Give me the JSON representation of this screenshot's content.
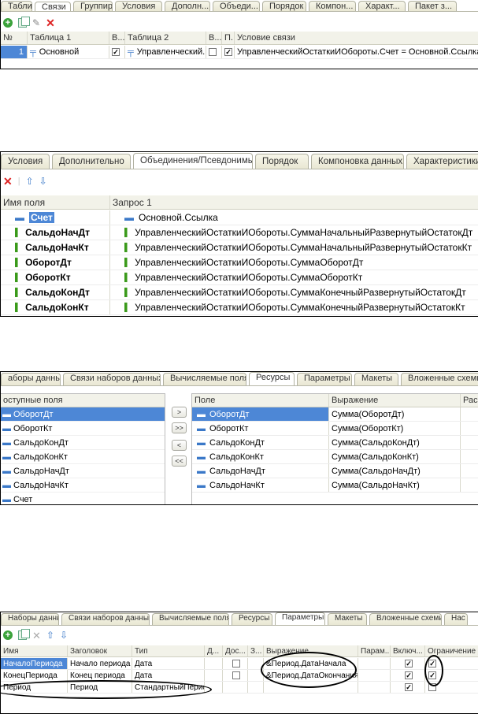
{
  "p1": {
    "tabs": [
      "Таблиц...",
      "Связи",
      "Группир...",
      "Условия",
      "Дополн...",
      "Объеди...",
      "Порядок",
      "Компон...",
      "Характ...",
      "Пакет з..."
    ],
    "headers": [
      "№",
      "Таблица 1",
      "В...",
      "Таблица 2",
      "В...",
      "П...",
      "Условие связи"
    ],
    "row": {
      "num": "1",
      "t1": "Основной",
      "t2": "Управленческий...",
      "cond": "УправленческийОстаткиИОбороты.Счет = Основной.Ссылка"
    }
  },
  "p2": {
    "tabs": [
      "Условия",
      "Дополнительно",
      "Объединения/Псевдонимы",
      "Порядок",
      "Компоновка данных",
      "Характеристики"
    ],
    "headers": [
      "Имя поля",
      "Запрос 1"
    ],
    "rows": [
      {
        "name": "Счет",
        "expr": "Основной.Ссылка"
      },
      {
        "name": "СальдоНачДт",
        "expr": "УправленческийОстаткиИОбороты.СуммаНачальныйРазвернутыйОстатокДт"
      },
      {
        "name": "СальдоНачКт",
        "expr": "УправленческийОстаткиИОбороты.СуммаНачальныйРазвернутыйОстатокКт"
      },
      {
        "name": "ОборотДт",
        "expr": "УправленческийОстаткиИОбороты.СуммаОборотДт"
      },
      {
        "name": "ОборотКт",
        "expr": "УправленческийОстаткиИОбороты.СуммаОборотКт"
      },
      {
        "name": "СальдоКонДт",
        "expr": "УправленческийОстаткиИОбороты.СуммаКонечныйРазвернутыйОстатокДт"
      },
      {
        "name": "СальдоКонКт",
        "expr": "УправленческийОстаткиИОбороты.СуммаКонечныйРазвернутыйОстатокКт"
      }
    ]
  },
  "p3": {
    "tabs": [
      "аборы данных",
      "Связи наборов данных",
      "Вычисляемые поля",
      "Ресурсы",
      "Параметры",
      "Макеты",
      "Вложенные схемы"
    ],
    "left_header": "оступные поля",
    "left": [
      "ОборотДт",
      "ОборотКт",
      "СальдоКонДт",
      "СальдоКонКт",
      "СальдоНачДт",
      "СальдоНачКт",
      "Счет"
    ],
    "buttons": [
      ">",
      ">>",
      "<",
      "<<"
    ],
    "headers": [
      "Поле",
      "Выражение",
      "Расс"
    ],
    "rows": [
      {
        "f": "ОборотДт",
        "e": "Сумма(ОборотДт)"
      },
      {
        "f": "ОборотКт",
        "e": "Сумма(ОборотКт)"
      },
      {
        "f": "СальдоКонДт",
        "e": "Сумма(СальдоКонДт)"
      },
      {
        "f": "СальдоКонКт",
        "e": "Сумма(СальдоКонКт)"
      },
      {
        "f": "СальдоНачДт",
        "e": "Сумма(СальдоНачДт)"
      },
      {
        "f": "СальдоНачКт",
        "e": "Сумма(СальдоНачКт)"
      }
    ]
  },
  "p4": {
    "tabs": [
      "Наборы данных",
      "Связи наборов данных",
      "Вычисляемые поля",
      "Ресурсы",
      "Параметры",
      "Макеты",
      "Вложенные схемы",
      "Нас"
    ],
    "headers": [
      "Имя",
      "Заголовок",
      "Тип",
      "Д...",
      "Дос...",
      "З...",
      "Выражение",
      "Парам...",
      "Включ...",
      "Ограничение д"
    ],
    "rows": [
      {
        "name": "НачалоПериода",
        "title": "Начало периода",
        "type": "Дата",
        "expr": "&Период.ДатаНачала",
        "dos": false,
        "inc": true,
        "lim": true
      },
      {
        "name": "КонецПериода",
        "title": "Конец периода",
        "type": "Дата",
        "expr": "&Период.ДатаОкончания",
        "dos": false,
        "inc": true,
        "lim": true
      },
      {
        "name": "Период",
        "title": "Период",
        "type": "СтандартныйПериод",
        "expr": "",
        "dos": null,
        "inc": true,
        "lim": false
      }
    ]
  },
  "colors": {
    "selection": "#4d87d6",
    "header": "#f2f2e9",
    "leaf": "#3a9a1a",
    "tab_active": "#ffffff"
  }
}
